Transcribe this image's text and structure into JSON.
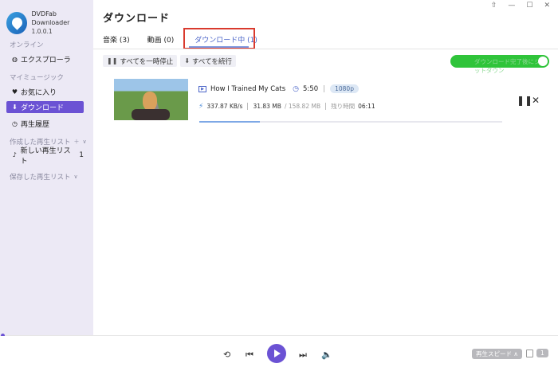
{
  "app": {
    "name": "DVDFab Downloader",
    "version": "1.0.0.1"
  },
  "window": {
    "pin": "⇧",
    "minimize": "—",
    "maximize": "☐",
    "close": "✕"
  },
  "sidebar": {
    "online_label": "オンライン",
    "explorer": "エクスプローラ",
    "my_music_label": "マイミュージック",
    "favorites": "お気に入り",
    "download": "ダウンロード",
    "history": "再生履歴",
    "created_playlists_label": "作成した再生リスト",
    "new_playlist": "新しい再生リスト",
    "new_playlist_count": "1",
    "saved_playlists_label": "保存した再生リスト"
  },
  "main": {
    "title": "ダウンロード",
    "tabs": [
      {
        "label": "音楽 (3)"
      },
      {
        "label": "動画 (0)"
      },
      {
        "label": "ダウンロード中 (1)"
      }
    ],
    "toolbar": {
      "pause_all": "すべてを一時停止",
      "resume_all": "すべてを続行"
    },
    "toggle_label": "ダウンロード完了後にシャットダウン"
  },
  "download_item": {
    "title": "How I Trained My Cats",
    "duration": "5:50",
    "quality": "1080p",
    "speed": "337.87 KB/s",
    "downloaded": "31.83 MB",
    "total": "/ 158.82 MB",
    "remaining_label": "残り時間",
    "remaining": "06:11",
    "progress_percent": 20
  },
  "player": {
    "speed_label": "再生スピード ∧",
    "sleep_count": "1"
  },
  "colors": {
    "accent": "#6b52d4",
    "toggle_on": "#2fc43a",
    "highlight_box": "#d93a2e"
  }
}
